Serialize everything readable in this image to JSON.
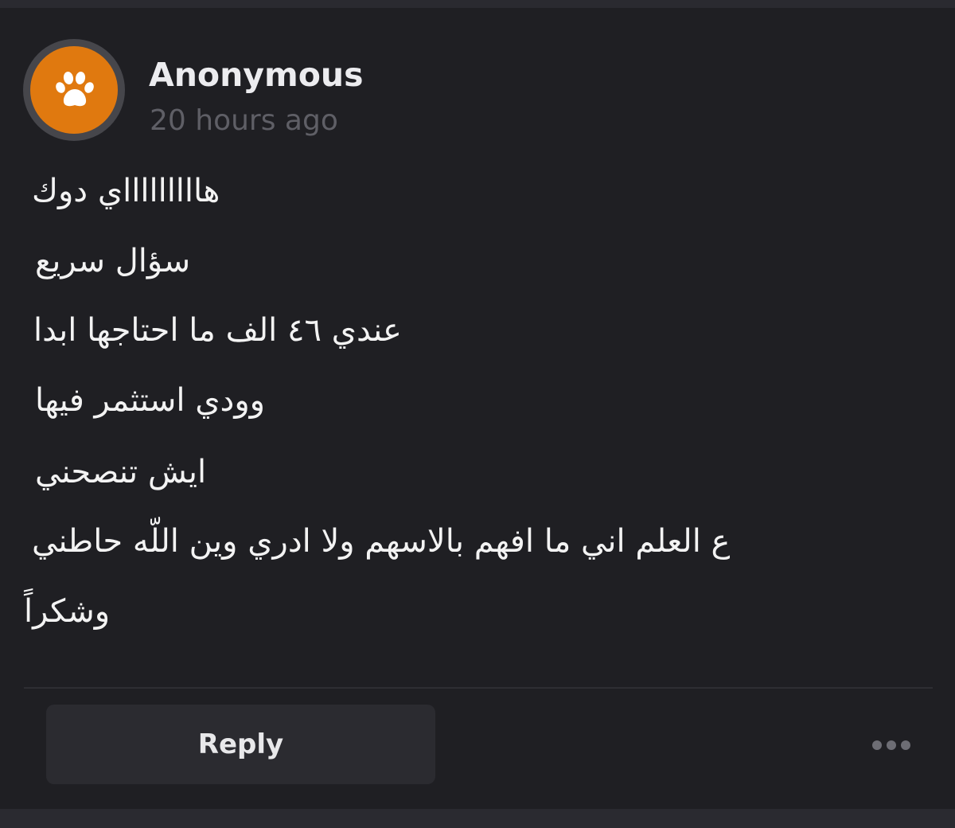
{
  "comment": {
    "author": "Anonymous",
    "timestamp": "20 hours ago",
    "avatar_icon": "paw-icon",
    "avatar_color": "#e0790f",
    "lines": [
      "هاااااااااي دوك",
      "سؤال سريع",
      "عندي ٤٦ الف ما احتاجها ابدا",
      "وودي استثمر فيها",
      "ايش تنصحني",
      "ع العلم اني ما افهم بالاسهم ولا ادري وين اللّه حاطني",
      "وشكراً"
    ]
  },
  "actions": {
    "reply_label": "Reply",
    "more_icon": "more-horizontal-icon"
  }
}
